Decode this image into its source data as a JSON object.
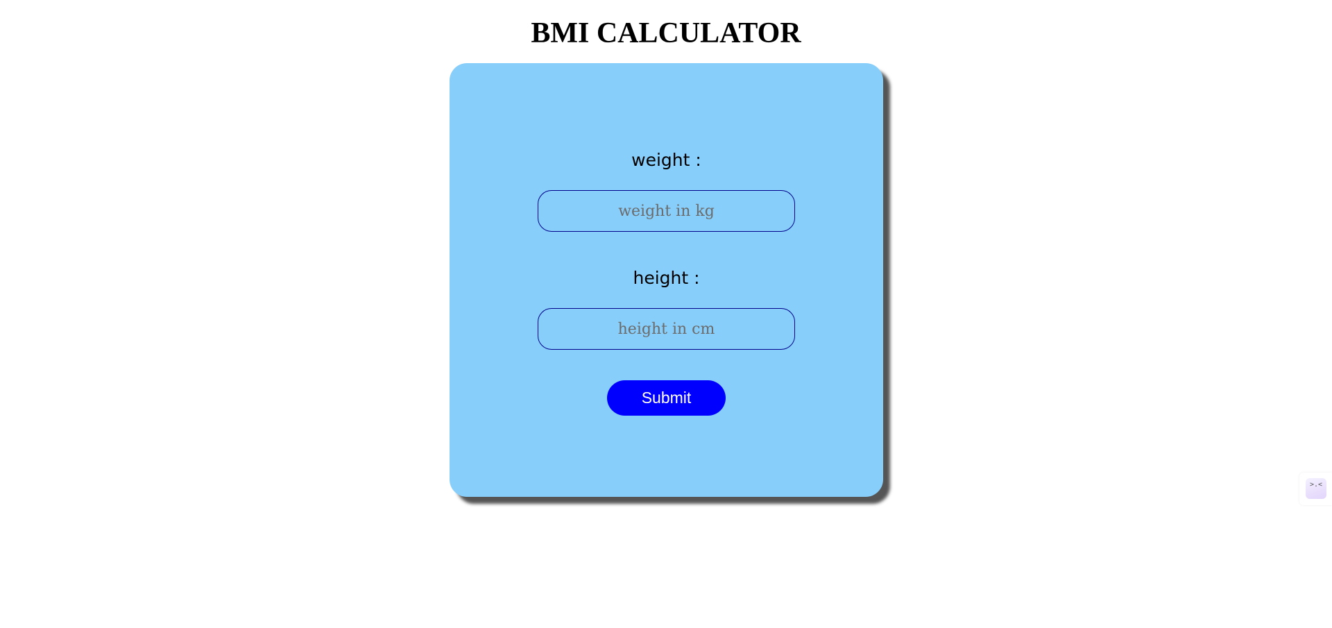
{
  "page": {
    "title": "BMI CALCULATOR"
  },
  "form": {
    "weight_label": "weight :",
    "weight_placeholder": "weight in kg",
    "weight_value": "",
    "height_label": "height :",
    "height_placeholder": "height in cm",
    "height_value": "",
    "submit_label": "Submit"
  },
  "colors": {
    "card_background": "#87cefa",
    "submit_background": "#0000ff",
    "input_border": "#00008b"
  },
  "widget": {
    "icon": "extension-assistant-icon",
    "glyph": ">.<"
  }
}
